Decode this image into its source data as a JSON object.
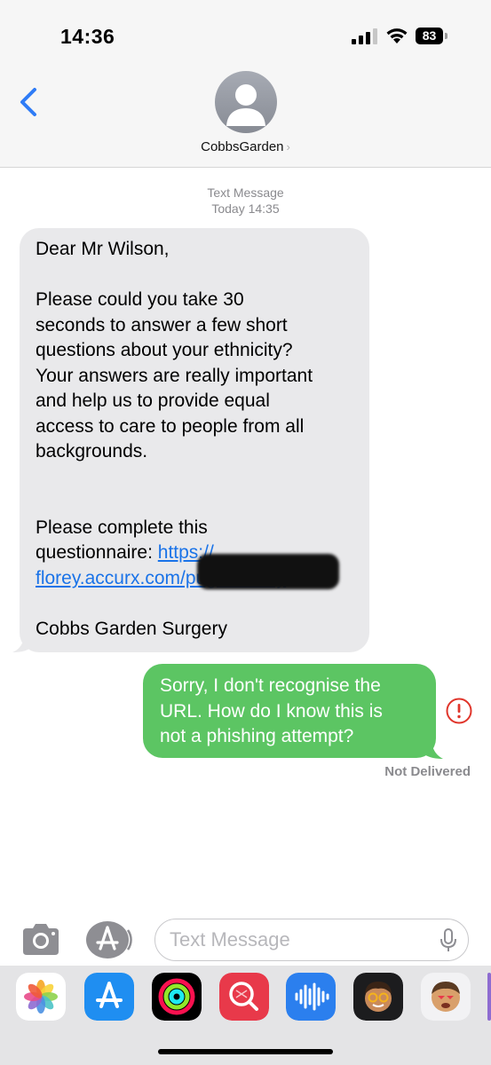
{
  "status_bar": {
    "time": "14:36",
    "battery": "83"
  },
  "header": {
    "contact_name": "CobbsGarden",
    "chevron": "›"
  },
  "thread": {
    "service": "Text Message",
    "date": "Today 14:35"
  },
  "incoming_message": {
    "greeting": "Dear Mr Wilson,",
    "paragraph1_line1": "Please could you take 30",
    "paragraph1_line2": "seconds to answer a few short",
    "paragraph1_line3": "questions about your ethnicity?",
    "paragraph1_line4": "Your answers are really important",
    "paragraph1_line5": "and help us to provide equal",
    "paragraph1_line6": "access to care to people from all",
    "paragraph1_line7": "backgrounds.",
    "cta_line1": "Please complete this",
    "cta_line2_prefix": "questionnaire: ",
    "link_part1": "https://",
    "link_part2": "florey.accurx.com/pugza7avby",
    "signature": "Cobbs Garden Surgery"
  },
  "outgoing_message": {
    "line1": "Sorry, I don't recognise the",
    "line2": "URL. How do I know this is",
    "line3": "not a phishing attempt?",
    "status": "Not Delivered"
  },
  "composer": {
    "placeholder": "Text Message"
  },
  "icons": {
    "back": "chevron-left-icon",
    "camera": "camera-icon",
    "apps": "app-store-icon",
    "mic": "microphone-icon",
    "error": "exclamation-circle-icon"
  },
  "colors": {
    "incoming_bubble": "#e9e9eb",
    "outgoing_bubble": "#5cc563",
    "link": "#1a73e8",
    "error": "#e0352b",
    "ios_blue": "#2f7cf6"
  },
  "app_drawer": [
    {
      "name": "photos-app-icon"
    },
    {
      "name": "app-store-app-icon"
    },
    {
      "name": "activity-app-icon"
    },
    {
      "name": "image-search-app-icon"
    },
    {
      "name": "audio-message-app-icon"
    },
    {
      "name": "memoji-app-icon"
    },
    {
      "name": "memoji-stickers-app-icon"
    },
    {
      "name": "extra-app-icon"
    }
  ]
}
